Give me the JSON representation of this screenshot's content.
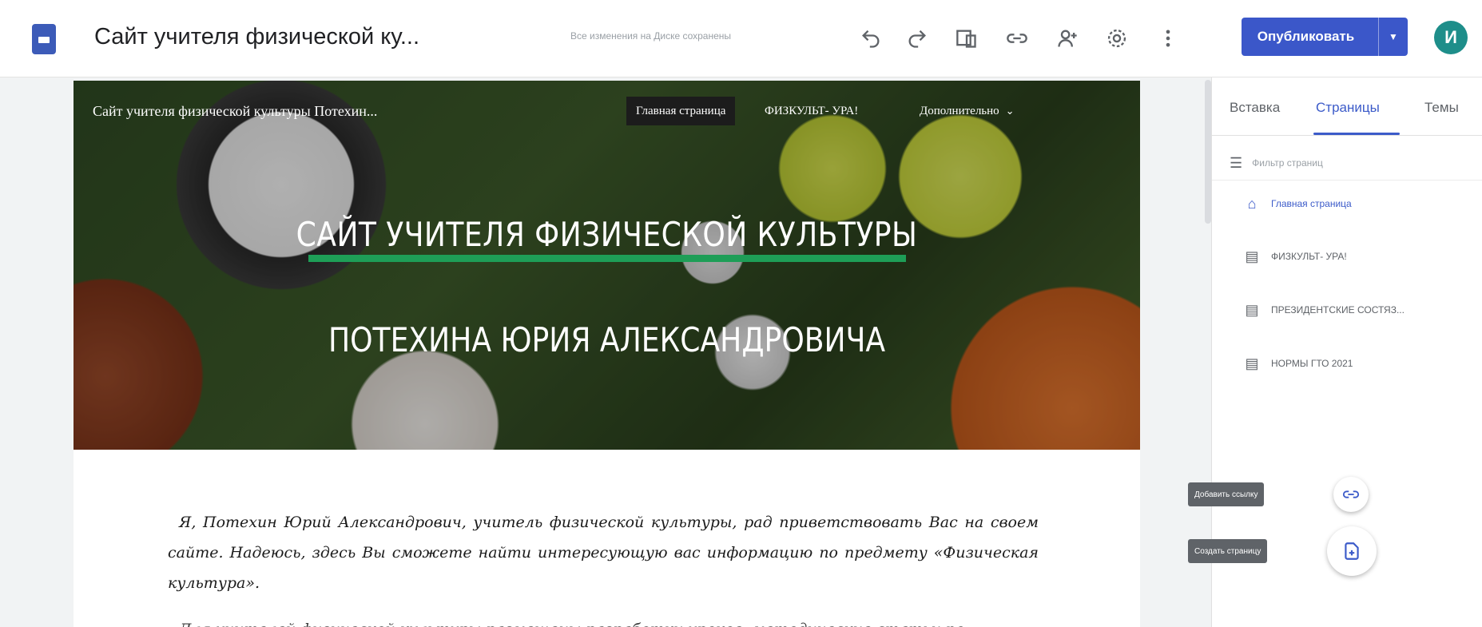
{
  "topbar": {
    "title": "Сайт учителя физической ку...",
    "save_status": "Все изменения на Диске сохранены",
    "publish_label": "Опубликовать",
    "avatar_letter": "И",
    "icons": [
      "undo-icon",
      "redo-icon",
      "preview-icon",
      "link-icon",
      "share-icon",
      "settings-icon",
      "more-vert-icon"
    ]
  },
  "site": {
    "name": "Сайт учителя физической культуры Потехин...",
    "nav": [
      {
        "label": "Главная страница"
      },
      {
        "label": "ФИЗКУЛЬТ- УРА!"
      },
      {
        "label": "Дополнительно"
      }
    ],
    "hero_title_1": "САЙТ УЧИТЕЛЯ ФИЗИЧЕСКОЙ КУЛЬТУРЫ",
    "hero_title_2": "ПОТЕХИНА ЮРИЯ АЛЕКСАНДРОВИЧА",
    "intro": "Я, Потехин Юрий Александрович, учитель физической культуры, рад приветствовать Вас на своем сайте. Надеюсь, здесь Вы сможете найти интересующую вас информацию по предмету «Физическая культура».",
    "intro_continued": "Для учителей физической культуры размещены разработки уроков, методические статьи по"
  },
  "panel": {
    "tabs": [
      {
        "label": "Вставка"
      },
      {
        "label": "Страницы"
      },
      {
        "label": "Темы"
      }
    ],
    "active_tab": "Страницы",
    "filter_placeholder": "Фильтр страниц",
    "pages": [
      {
        "label": "Главная страница",
        "icon": "home-icon"
      },
      {
        "label": "ФИЗКУЛЬТ- УРА!",
        "icon": "page-icon"
      },
      {
        "label": "ПРЕЗИДЕНТСКИЕ СОСТЯЗ...",
        "icon": "page-icon"
      },
      {
        "label": "НОРМЫ ГТО 2021",
        "icon": "page-icon"
      }
    ],
    "tooltip_link": "Добавить ссылку",
    "tooltip_page": "Создать страницу"
  },
  "colors": {
    "accent": "#3c5bc9",
    "hero_bar": "#1e9e57",
    "avatar": "#1e8e8a"
  }
}
